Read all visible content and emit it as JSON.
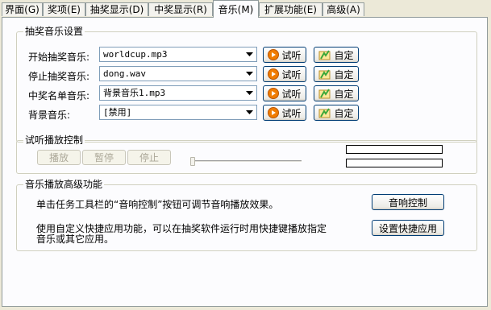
{
  "tabs": [
    {
      "label": "界面(G)"
    },
    {
      "label": "奖项(E)"
    },
    {
      "label": "抽奖显示(D)"
    },
    {
      "label": "中奖显示(R)"
    },
    {
      "label": "音乐(M)"
    },
    {
      "label": "扩展功能(E)"
    },
    {
      "label": "高级(A)"
    }
  ],
  "music_settings": {
    "title": "抽奖音乐设置",
    "rows": [
      {
        "label": "开始抽奖音乐:",
        "value": "worldcup.mp3"
      },
      {
        "label": "停止抽奖音乐:",
        "value": "dong.wav"
      },
      {
        "label": "中奖名单音乐:",
        "value": "背景音乐1.mp3"
      },
      {
        "label": "背景音乐:",
        "value": "[禁用]"
      }
    ],
    "preview_label": "试听",
    "custom_label": "自定"
  },
  "playback": {
    "title": "试听播放控制",
    "play_label": "播放",
    "pause_label": "暂停",
    "stop_label": "停止"
  },
  "advanced": {
    "title": "音乐播放高级功能",
    "line1": "单击任务工具栏的“音响控制”按钮可调节音响播放效果。",
    "line2": "使用自定义快捷应用功能，可以在抽奖软件运行时用快捷键播放指定",
    "line3": "音乐或其它应用。",
    "sound_control_label": "音响控制",
    "shortcut_label": "设置快捷应用"
  },
  "colors": {
    "window_bg": "#ece9d8",
    "panel_bg": "#fcfcfe",
    "play_icon": "#f07c00",
    "custom_icon": "#3aa83a"
  }
}
